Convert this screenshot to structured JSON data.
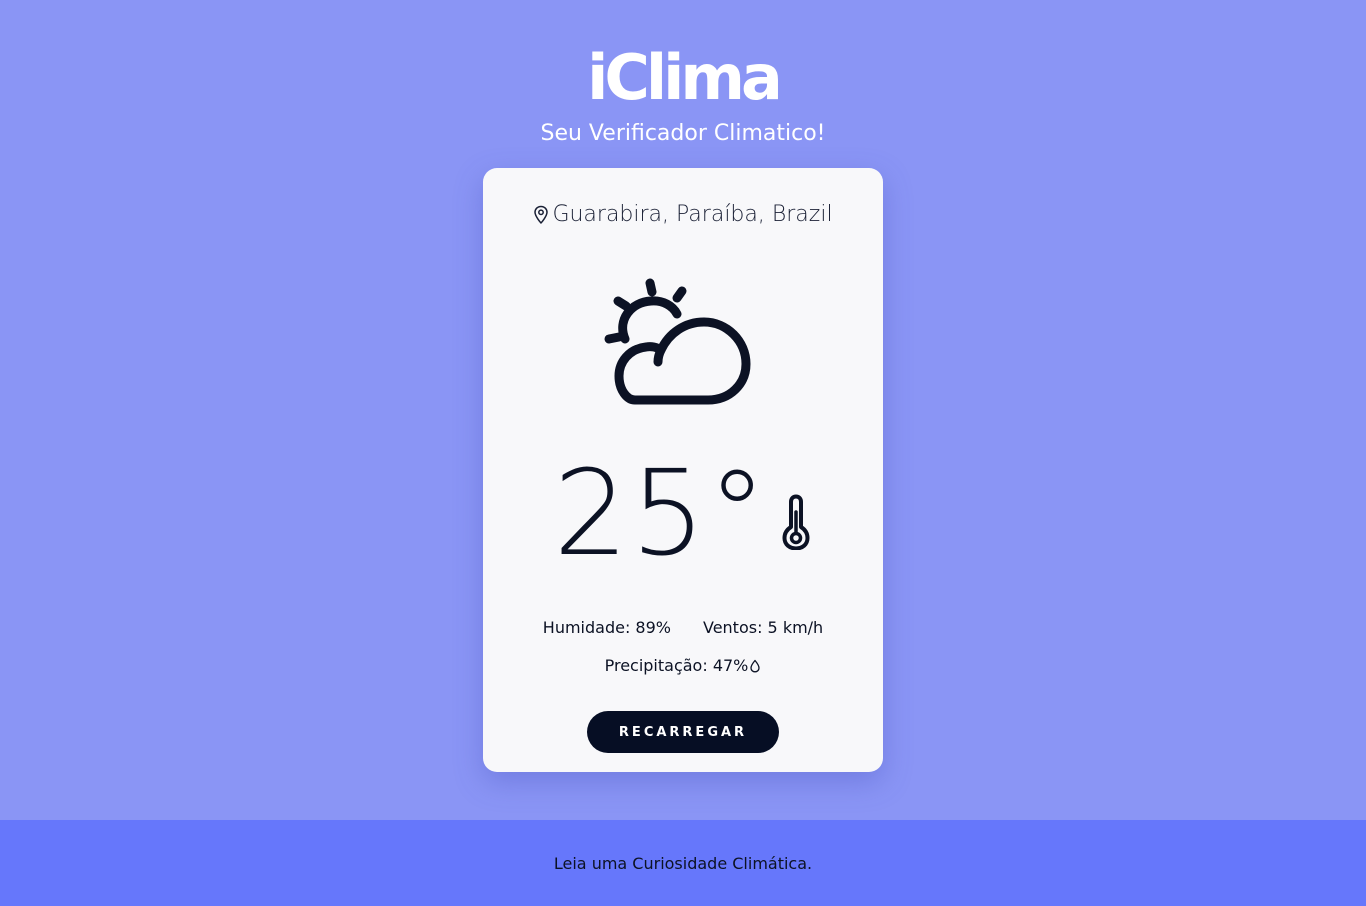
{
  "header": {
    "title": "iClima",
    "subtitle": "Seu Verificador Climatico!"
  },
  "weather": {
    "location": "Guarabira, Paraíba, Brazil",
    "condition_icon": "partly-cloudy-icon",
    "temperature": "25°",
    "humidity": "Humidade: 89%",
    "wind": "Ventos: 5 km/h",
    "precipitation": "Precipitação: 47%"
  },
  "actions": {
    "reload_label": "RECARREGAR"
  },
  "footer": {
    "link_text": "Leia uma Curiosidade Climática."
  },
  "colors": {
    "background": "#8a95f5",
    "card": "#f8f8fa",
    "footer": "#6677fb",
    "button": "#060e24",
    "text_dark": "#0c1224"
  }
}
